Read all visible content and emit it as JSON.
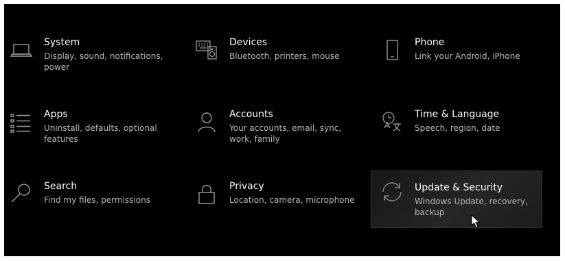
{
  "tiles": [
    {
      "id": "system",
      "icon": "laptop-icon",
      "title": "System",
      "description": "Display, sound, notifications, power"
    },
    {
      "id": "devices",
      "icon": "keyboard-speaker-icon",
      "title": "Devices",
      "description": "Bluetooth, printers, mouse"
    },
    {
      "id": "phone",
      "icon": "phone-icon",
      "title": "Phone",
      "description": "Link your Android, iPhone"
    },
    {
      "id": "apps",
      "icon": "apps-list-icon",
      "title": "Apps",
      "description": "Uninstall, defaults, optional features"
    },
    {
      "id": "accounts",
      "icon": "person-icon",
      "title": "Accounts",
      "description": "Your accounts, email, sync, work, family"
    },
    {
      "id": "time-language",
      "icon": "time-language-icon",
      "title": "Time & Language",
      "description": "Speech, region, date"
    },
    {
      "id": "search",
      "icon": "search-icon",
      "title": "Search",
      "description": "Find my files, permissions"
    },
    {
      "id": "privacy",
      "icon": "lock-icon",
      "title": "Privacy",
      "description": "Location, camera, microphone"
    },
    {
      "id": "update-security",
      "icon": "sync-arrows-icon",
      "title": "Update & Security",
      "description": "Windows Update, recovery, backup",
      "hovered": true
    }
  ],
  "colors": {
    "background": "#000000",
    "title": "#ffffff",
    "description": "#b8b8b8",
    "icon": "#9a9a9a",
    "hover_border": "#3a3a3a"
  }
}
